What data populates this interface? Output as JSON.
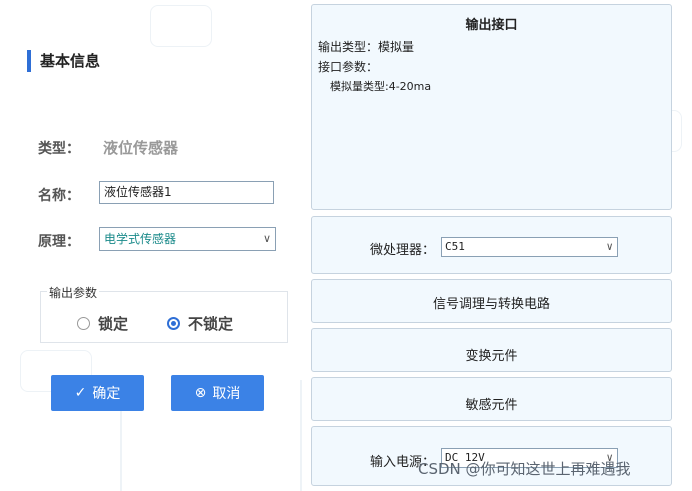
{
  "basic_info": {
    "title": "基本信息",
    "type_label": "类型：",
    "type_value": "液位传感器",
    "name_label": "名称：",
    "name_value": "液位传感器1",
    "principle_label": "原理：",
    "principle_value": "电学式传感器",
    "output_group_label": "输出参数",
    "radio_locked": "锁定",
    "radio_unlocked": "不锁定",
    "selected_radio": "不锁定",
    "confirm_label": "确定",
    "cancel_label": "取消"
  },
  "output_interface": {
    "title": "输出接口",
    "output_type": "输出类型：模拟量",
    "interface_params": "接口参数：",
    "analog_type": "模拟量类型:4-20ma"
  },
  "microprocessor": {
    "label": "微处理器：",
    "value": "C51"
  },
  "signal_circuit": {
    "label": "信号调理与转换电路"
  },
  "transform_element": {
    "label": "变换元件"
  },
  "sensing_element": {
    "label": "敏感元件"
  },
  "power_input": {
    "label": "输入电源：",
    "value": "DC 12V"
  },
  "watermark": "CSDN @你可知这世上再难遇我",
  "colors": {
    "accent": "#3b82e6",
    "panel_bg": "#f2f9fe",
    "section_bar": "#2f6fd6"
  }
}
